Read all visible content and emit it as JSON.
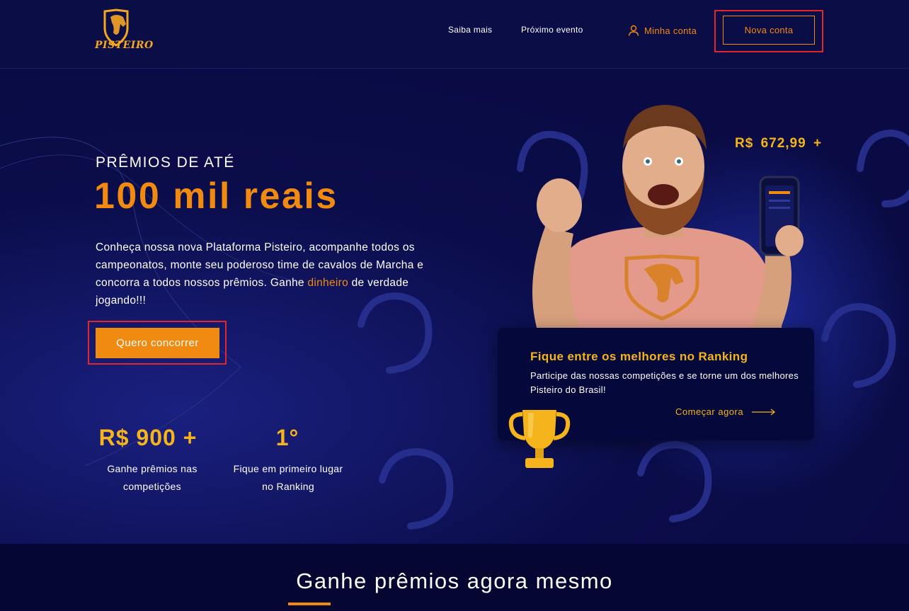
{
  "header": {
    "logo_text": "PISTEIRO",
    "nav": [
      "Saiba mais",
      "Próximo evento"
    ],
    "account_label": "Minha conta",
    "new_account_label": "Nova conta"
  },
  "hero": {
    "prize_label": "PRÊMIOS DE ATÉ",
    "prize_value": "100 mil reais",
    "intro_before": "Conheça nossa nova Plataforma Pisteiro, acompanhe todos os campeonatos, monte seu poderoso time de cavalos de Marcha e concorra a todos nossos prêmios. Ganhe ",
    "intro_highlight": "dinheiro",
    "intro_after": " de verdade jogando!!!",
    "cta_label": "Quero concorrer",
    "stats": [
      {
        "value": "R$ 900 +",
        "caption_line1": "Ganhe prêmios nas",
        "caption_line2": "competições"
      },
      {
        "value": "1°",
        "caption_line1": "Fique em primeiro lugar",
        "caption_line2": "no Ranking"
      }
    ],
    "price_tag": "R$ 672,99 +",
    "rank_card": {
      "title": "Fique entre os melhores no Ranking",
      "text": "Participe das nossas competições e se torne um dos melhores Pisteiro do Brasil!",
      "link_label": "Começar agora"
    }
  },
  "section": {
    "title": "Ganhe prêmios agora mesmo"
  },
  "colors": {
    "background": "#0a0b45",
    "accent_orange": "#f08a11",
    "accent_gold": "#f5b41b",
    "highlight_box": "#e3262c"
  }
}
